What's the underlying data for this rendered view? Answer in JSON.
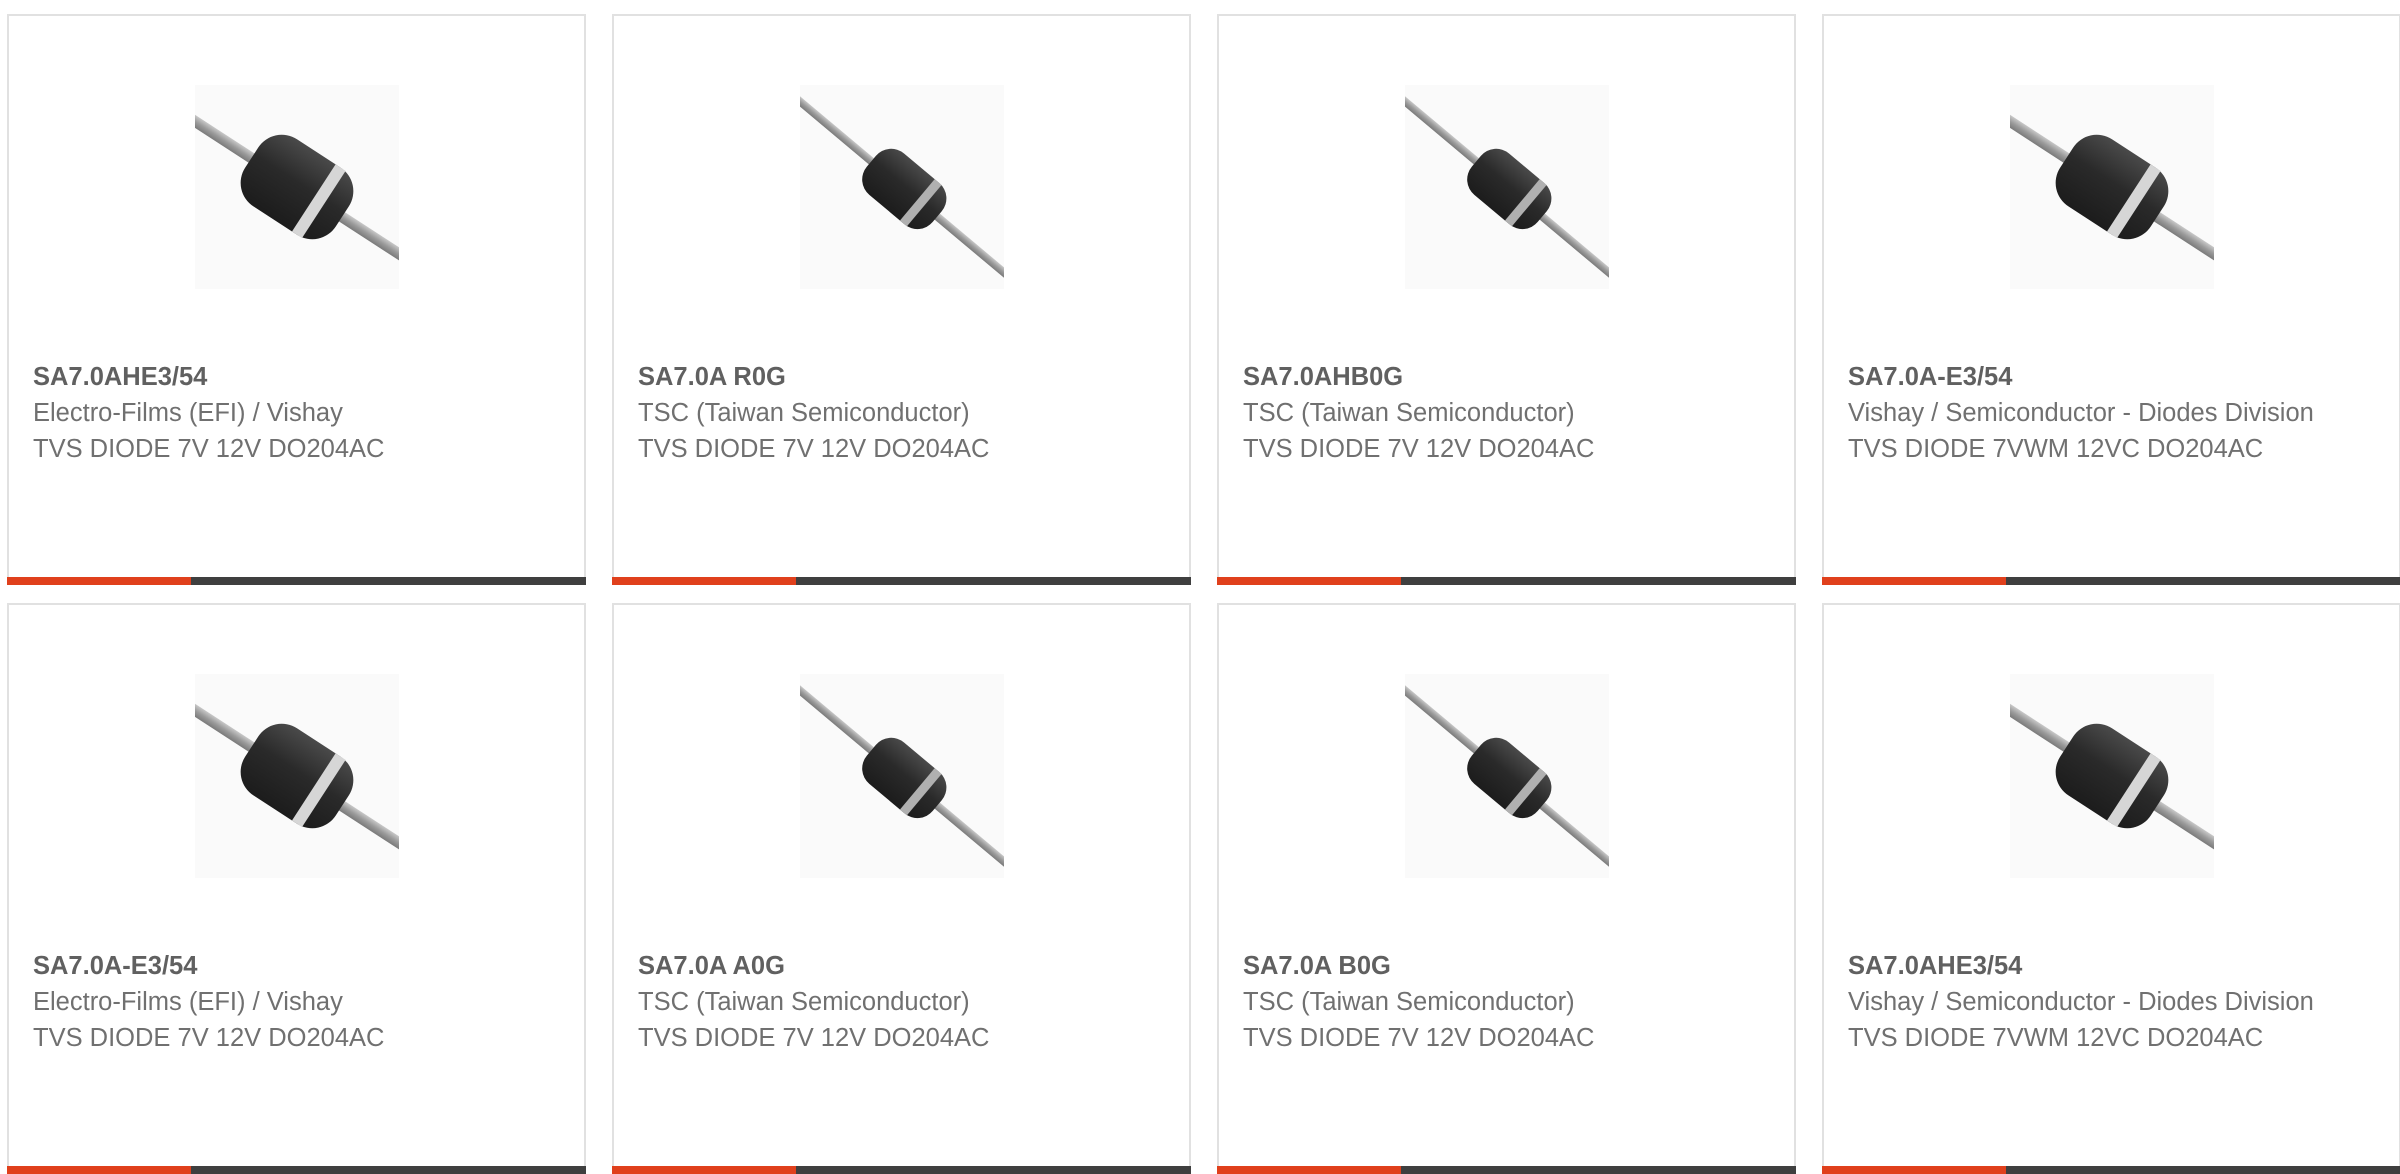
{
  "colors": {
    "card_border": "#e1e1e1",
    "accent": "#e0401c",
    "bar": "#3f3f3f",
    "text": "#707070"
  },
  "products": [
    {
      "image_icon": "diode-do204ac-large-band-icon",
      "part_number": "SA7.0AHE3/54",
      "manufacturer": "Electro-Films (EFI) / Vishay",
      "description": "TVS DIODE 7V 12V DO204AC"
    },
    {
      "image_icon": "diode-do204ac-small-band-icon",
      "part_number": "SA7.0A R0G",
      "manufacturer": "TSC (Taiwan Semiconductor)",
      "description": "TVS DIODE 7V 12V DO204AC"
    },
    {
      "image_icon": "diode-do204ac-small-band-icon",
      "part_number": "SA7.0AHB0G",
      "manufacturer": "TSC (Taiwan Semiconductor)",
      "description": "TVS DIODE 7V 12V DO204AC"
    },
    {
      "image_icon": "diode-do204ac-large-band-icon",
      "part_number": "SA7.0A-E3/54",
      "manufacturer": "Vishay / Semiconductor - Diodes Division",
      "description": "TVS DIODE 7VWM 12VC DO204AC"
    },
    {
      "image_icon": "diode-do204ac-large-band-icon",
      "part_number": "SA7.0A-E3/54",
      "manufacturer": "Electro-Films (EFI) / Vishay",
      "description": "TVS DIODE 7V 12V DO204AC"
    },
    {
      "image_icon": "diode-do204ac-small-band-icon",
      "part_number": "SA7.0A A0G",
      "manufacturer": "TSC (Taiwan Semiconductor)",
      "description": "TVS DIODE 7V 12V DO204AC"
    },
    {
      "image_icon": "diode-do204ac-small-band-icon",
      "part_number": "SA7.0A B0G",
      "manufacturer": "TSC (Taiwan Semiconductor)",
      "description": "TVS DIODE 7V 12V DO204AC"
    },
    {
      "image_icon": "diode-do204ac-large-band-icon",
      "part_number": "SA7.0AHE3/54",
      "manufacturer": "Vishay / Semiconductor - Diodes Division",
      "description": "TVS DIODE 7VWM 12VC DO204AC"
    }
  ]
}
